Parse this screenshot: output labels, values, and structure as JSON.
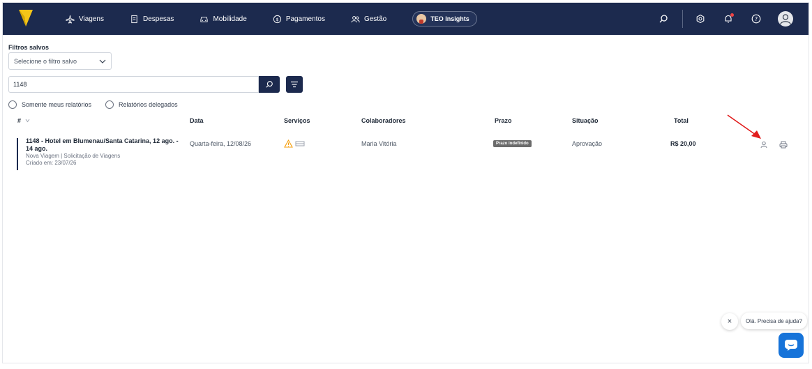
{
  "nav": {
    "items": [
      {
        "label": "Viagens",
        "icon": "plane-icon"
      },
      {
        "label": "Despesas",
        "icon": "receipt-icon"
      },
      {
        "label": "Mobilidade",
        "icon": "car-icon"
      },
      {
        "label": "Pagamentos",
        "icon": "dollar-icon"
      },
      {
        "label": "Gestão",
        "icon": "users-icon"
      }
    ],
    "teo_label": "TEO Insights"
  },
  "filters": {
    "saved_label": "Filtros salvos",
    "saved_select_value": "Selecione o filtro salvo",
    "search_value": "1148",
    "radio_mine": "Somente meus relatórios",
    "radio_delegated": "Relatórios delegados"
  },
  "table": {
    "headers": {
      "id": "#",
      "date": "Data",
      "services": "Serviços",
      "collaborators": "Colaboradores",
      "deadline": "Prazo",
      "status": "Situação",
      "total": "Total"
    },
    "rows": [
      {
        "title": "1148 - Hotel em Blumenau/Santa Catarina, 12 ago. - 14 ago.",
        "subtitle": "Nova Viagem | Solicitação de Viagens",
        "created": "Criado em: 23/07/26",
        "date": "Quarta-feira, 12/08/26",
        "collaborator": "Maria Vitória",
        "deadline": "Prazo indefinido",
        "status": "Aprovação",
        "total": "R$ 20,00"
      }
    ]
  },
  "chat": {
    "prompt": "Olá. Precisa de ajuda?",
    "close": "×"
  },
  "colors": {
    "navbar": "#1c2a4e",
    "accent_yellow": "#f5c518",
    "chat_blue": "#1673d9",
    "annotation_arrow": "#e11d1d"
  }
}
